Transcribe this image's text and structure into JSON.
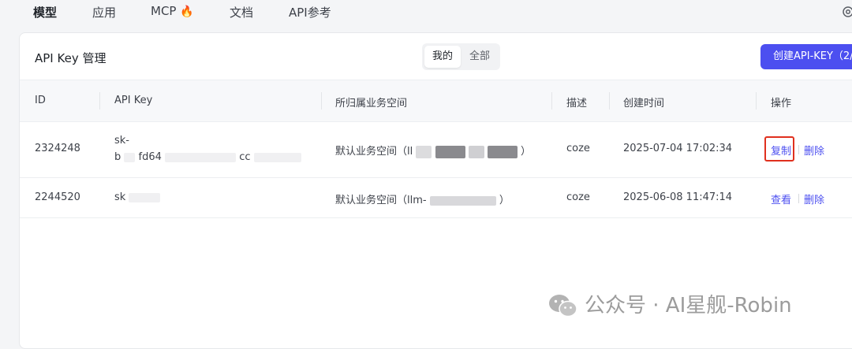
{
  "nav": {
    "items": [
      {
        "label": "模型",
        "active": true
      },
      {
        "label": "应用",
        "active": false
      },
      {
        "label": "MCP",
        "active": false,
        "emoji": "🔥"
      },
      {
        "label": "文档",
        "active": false
      },
      {
        "label": "API参考",
        "active": false
      }
    ],
    "settings_icon": "gear-icon"
  },
  "card": {
    "title": "API Key 管理",
    "segment": {
      "mine": "我的",
      "all": "全部",
      "selected": "我的"
    },
    "create_button": "创建API-KEY（2/"
  },
  "table": {
    "headers": [
      "ID",
      "API Key",
      "所归属业务空间",
      "描述",
      "创建时间",
      "操作"
    ],
    "rows": [
      {
        "id": "2324248",
        "key_line1": "sk-",
        "key_line2a": "b",
        "key_line2b": "fd64",
        "key_line2c": "cc",
        "space": "默认业务空间（ll",
        "space_end": "）",
        "desc": "coze",
        "created": "2025-07-04 17:02:34",
        "op1": "复制",
        "op2": "删除"
      },
      {
        "id": "2244520",
        "key": "sk",
        "space": "默认业务空间（llm-",
        "space_end": "）",
        "desc": "coze",
        "created": "2025-06-08 11:47:14",
        "op1": "查看",
        "op2": "删除"
      }
    ]
  },
  "watermark": {
    "text": "公众号 · AI星舰-Robin",
    "icon": "wechat-icon",
    "color": "#9c9c9c"
  },
  "colors": {
    "accent": "#4c4ff0",
    "highlight": "#e0301e"
  }
}
